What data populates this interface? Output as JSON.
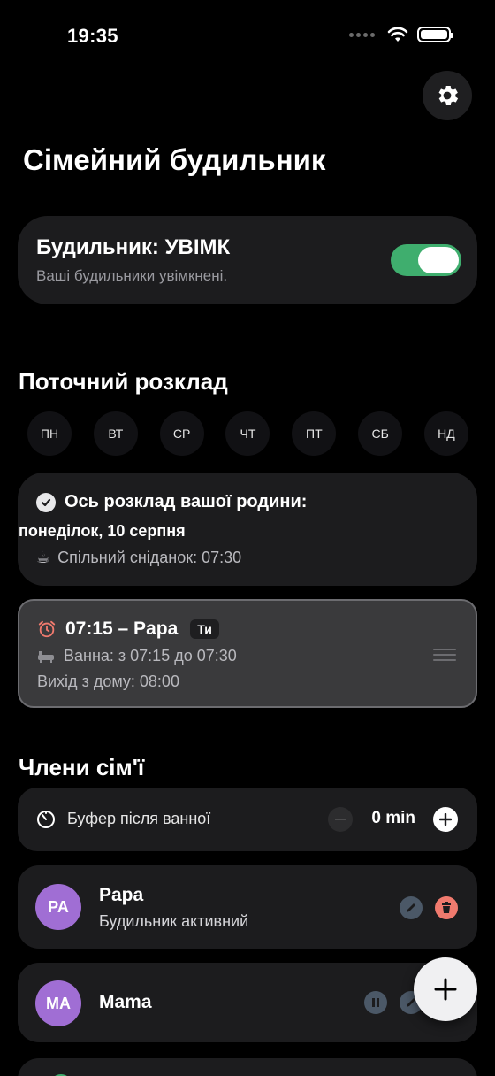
{
  "status_bar": {
    "time": "19:35"
  },
  "header": {
    "title": "Сімейний будильник"
  },
  "alarm": {
    "title": "Будильник: УВІМК",
    "subtitle": "Ваші будильники увімкнені.",
    "enabled": true,
    "accent_color": "#3fae6e"
  },
  "schedule": {
    "section_title": "Поточний розклад",
    "days": [
      "ПН",
      "ВТ",
      "СР",
      "ЧТ",
      "ПТ",
      "СБ",
      "НД"
    ],
    "summary": {
      "heading": "Ось розклад вашої родини:",
      "date": "понеділок, 10 серпня",
      "breakfast_icon": "☕",
      "breakfast": "Спільний сніданок: 07:30"
    },
    "entry": {
      "alarm_icon": "alarm-clock-icon",
      "time_name": "07:15 – Papa",
      "badge": "Ти",
      "bath_icon": "bathtub-icon",
      "bath": "Ванна: з 07:15 до 07:30",
      "leave": "Вихід з дому: 08:00"
    }
  },
  "family": {
    "section_title": "Члени сім'ї",
    "buffer": {
      "label": "Буфер після ванної",
      "value": "0 min"
    },
    "members": [
      {
        "initials": "PA",
        "name": "Papa",
        "status": "Будильник активний",
        "avatar_color": "#a06ed4"
      },
      {
        "initials": "MA",
        "name": "Mama",
        "status": "",
        "avatar_color": "#a06ed4"
      }
    ]
  },
  "colors": {
    "background": "#000000",
    "card": "#1c1c1e",
    "delete": "#f07a6e",
    "accent": "#3fae6e"
  }
}
